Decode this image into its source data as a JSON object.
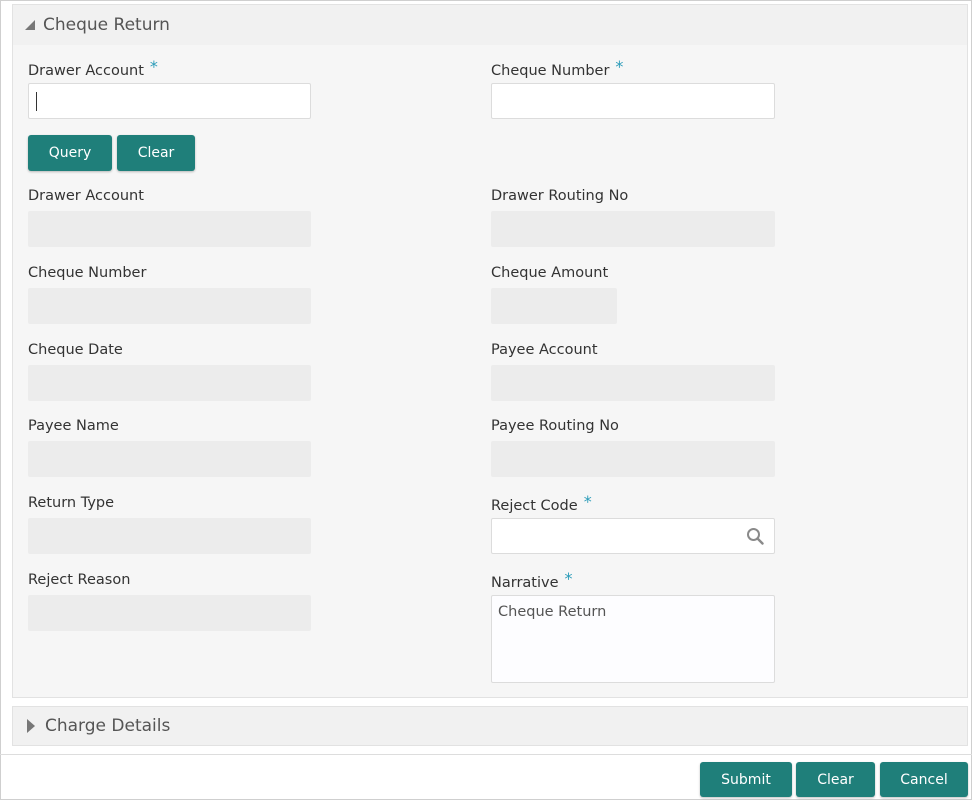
{
  "cheque_return": {
    "title": "Cheque Return",
    "required_mark": "*",
    "drawer_account_label": "Drawer Account",
    "cheque_number_label": "Cheque Number",
    "query_label": "Query",
    "clear_label": "Clear",
    "fields": {
      "drawer_account": "Drawer Account",
      "drawer_routing_no": "Drawer Routing No",
      "cheque_number": "Cheque Number",
      "cheque_amount": "Cheque Amount",
      "cheque_date": "Cheque Date",
      "payee_account": "Payee Account",
      "payee_name": "Payee Name",
      "payee_routing_no": "Payee Routing No",
      "return_type": "Return Type",
      "reject_code": "Reject Code",
      "reject_reason": "Reject Reason",
      "narrative": "Narrative"
    },
    "narrative_value": "Cheque Return"
  },
  "charge_details": {
    "title": "Charge Details"
  },
  "footer": {
    "submit_label": "Submit",
    "clear_label": "Clear",
    "cancel_label": "Cancel"
  },
  "colors": {
    "accent_button": "#1f7f7a",
    "required_mark": "#2a9bb8"
  }
}
